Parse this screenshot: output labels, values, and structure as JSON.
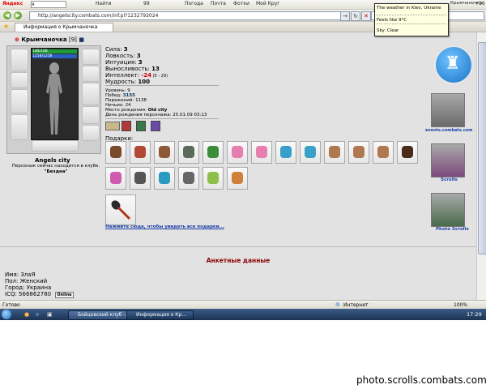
{
  "browser": {
    "yandex_bar": {
      "brand": "Яндекс",
      "search_value": "я",
      "find_label": "Найти",
      "count": "99",
      "links": [
        "Погода",
        "Почта",
        "Фотки",
        "Мой Круг"
      ],
      "right_text": "Крымчаночка",
      "right_count": "+16"
    },
    "url": "http://angelscity.combats.com/inf.pl?1232792024",
    "tab_title": "Информация о Крымчаночка"
  },
  "tooltip": {
    "line1": "The weather in Kiev, Ukraine",
    "line2": "Feels like 9°C",
    "line3": "Sky: Clear"
  },
  "character": {
    "name": "Крымчаночка",
    "level": "[9]",
    "hp_bar": "188/188",
    "mana_bar": "1258/1258",
    "city": "Angels city",
    "location_text": "Персонаж сейчас находится в клубе.",
    "location_place": "\"Бездна\"",
    "stats": [
      {
        "label": "Сила: ",
        "value": "3"
      },
      {
        "label": "Ловкость: ",
        "value": "3"
      },
      {
        "label": "Интуиция: ",
        "value": "3"
      },
      {
        "label": "Выносливость: ",
        "value": "13"
      },
      {
        "label": "Интеллект: ",
        "value": "-24",
        "extra": " (5 - 29)"
      },
      {
        "label": "Мудрость: ",
        "value": "100"
      }
    ],
    "info": [
      {
        "label": "Уровень: ",
        "value": "9"
      },
      {
        "label": "Побед: ",
        "value": "3155"
      },
      {
        "label": "Поражений: ",
        "value": "1138"
      },
      {
        "label": "Ничьих: ",
        "value": "24"
      },
      {
        "label": "Место рождения: ",
        "value": "Old city"
      },
      {
        "label": "День рождения персонажа: ",
        "value": "25.01.09 03:13"
      }
    ],
    "gifts_title": "Подарки:",
    "more_gifts_link": "Нажмите сюда, чтобы увидеть все подарки...",
    "profile_header": "Анкетные данные",
    "profile": [
      {
        "label": "Имя: ",
        "value": "ЗлаЯ"
      },
      {
        "label": "Пол: ",
        "value": "Женский"
      },
      {
        "label": "Город: ",
        "value": "Украина"
      },
      {
        "label": "ICQ: ",
        "value": "566862780",
        "badge": "Online"
      }
    ]
  },
  "sidebar": {
    "events_label": "events.combats.com",
    "scrolls_label": "Scrolls",
    "photo_label": "Photo Scrolls"
  },
  "gift_colors": [
    "#7a4b2a",
    "#b04a35",
    "#8c5a3a",
    "#5a6b5a",
    "#3c8c3c",
    "#e67fb0",
    "#e67fb0",
    "#3aa0c8",
    "#3aa0c8",
    "#b07850",
    "#b07850",
    "#b07850",
    "#4b2a1a",
    "#d05ab0",
    "#555555",
    "#2a9ac0",
    "#666666",
    "#8cc04b",
    "#d0803a"
  ],
  "status": {
    "left": "Готово",
    "internet": "Интернет",
    "zoom": "100%"
  },
  "taskbar": {
    "tasks": [
      "Бойцовский клуб -...",
      "Информация о Кр..."
    ],
    "clock": "17:29"
  },
  "watermark": "photo.scrolls.combats.com"
}
